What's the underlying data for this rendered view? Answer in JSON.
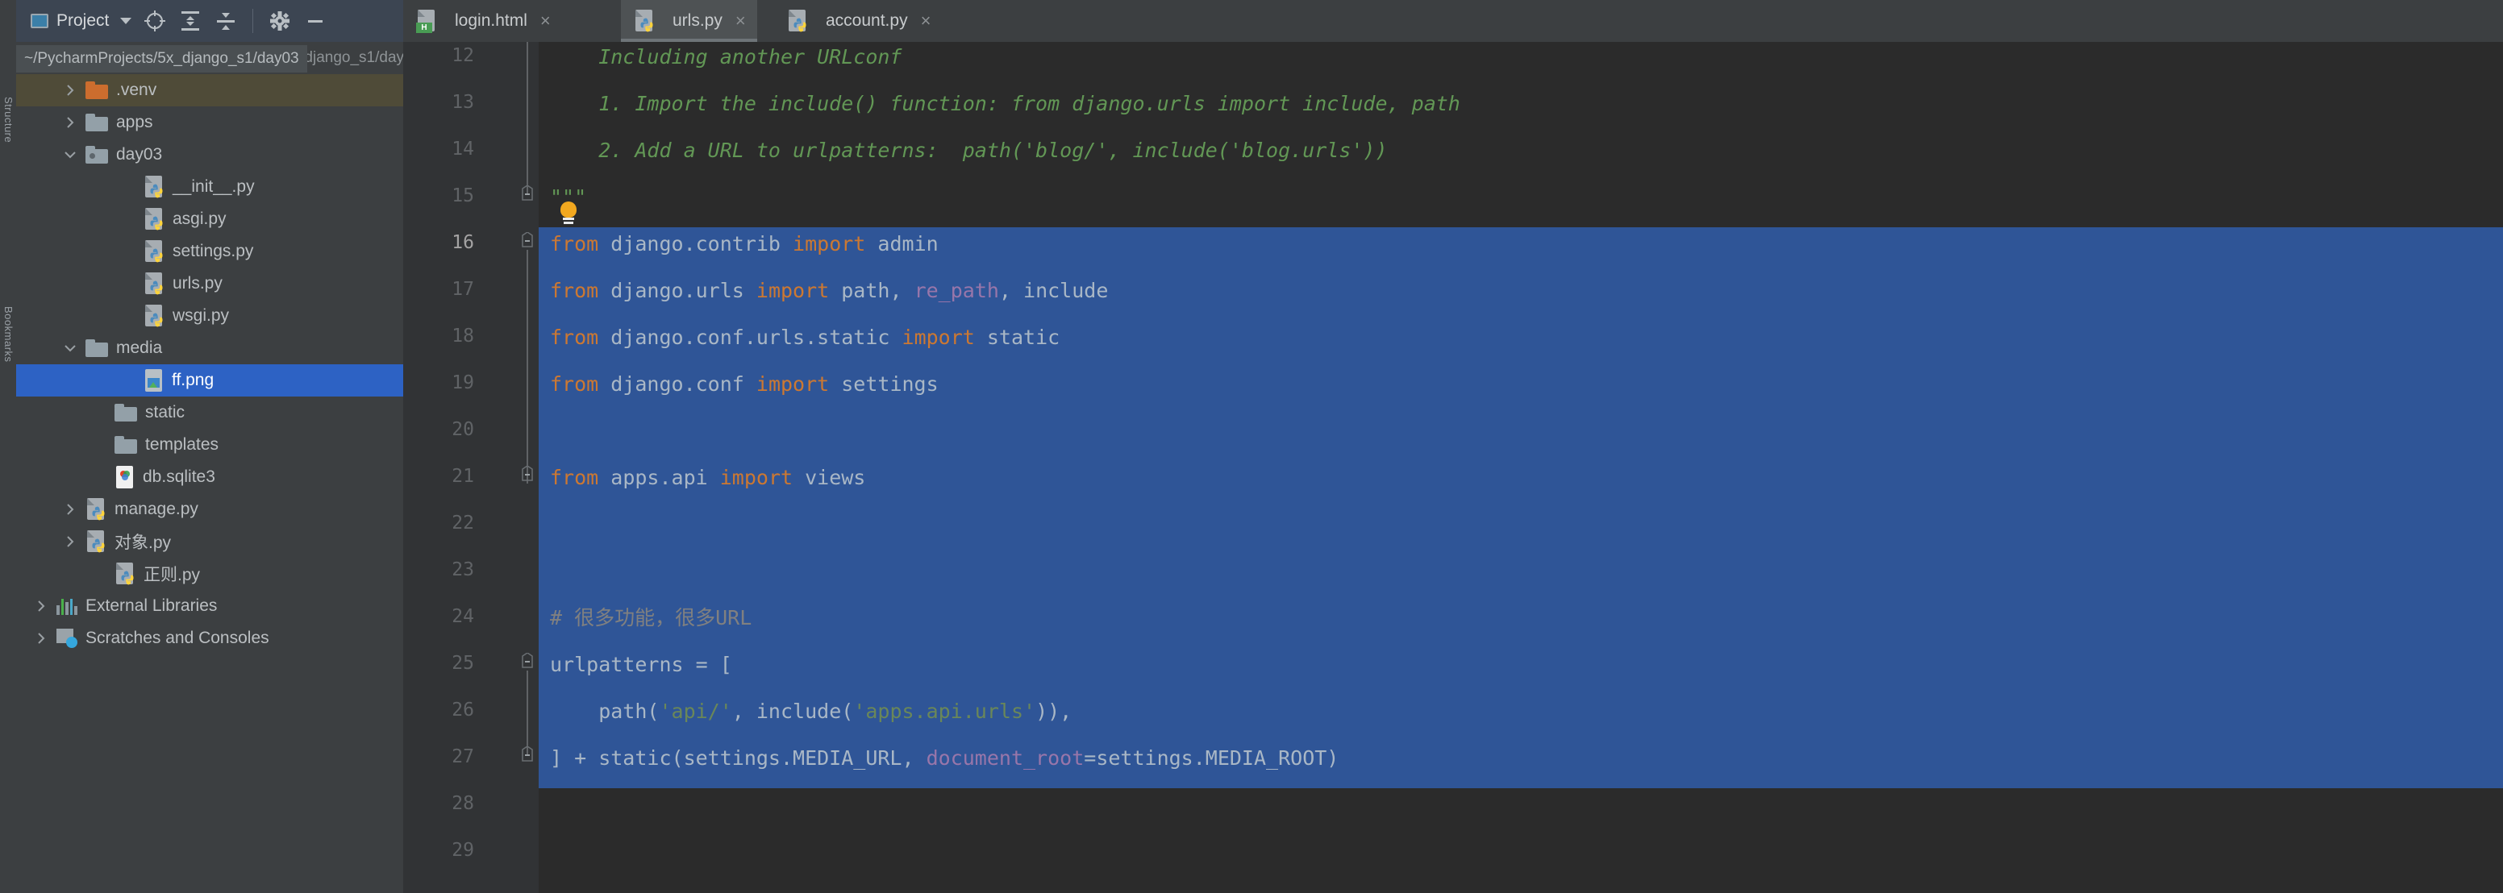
{
  "toolbar": {
    "project_label": "Project",
    "icons": [
      {
        "name": "locate-icon",
        "glyph": "target"
      },
      {
        "name": "expand-all-icon",
        "glyph": "expand"
      },
      {
        "name": "collapse-all-icon",
        "glyph": "collapse"
      },
      {
        "name": "settings-gear-icon",
        "glyph": "gear"
      },
      {
        "name": "hide-panel-icon",
        "glyph": "minus"
      }
    ]
  },
  "left_strip": {
    "labels": [
      "Structure",
      "Bookmarks"
    ]
  },
  "tabs": [
    {
      "label": "login.html",
      "icon": "html-file-icon",
      "active": false,
      "close": "×"
    },
    {
      "label": "urls.py",
      "icon": "python-file-icon",
      "active": true,
      "close": "×"
    },
    {
      "label": "account.py",
      "icon": "python-file-icon",
      "active": false,
      "close": "×"
    }
  ],
  "path_tooltip": "~/PycharmProjects/5x_django_s1/day03",
  "project_tree": {
    "root_label": "day03",
    "root_path": "~/PycharmProjects/5x_django_s1/day03",
    "items": [
      {
        "label": "day03",
        "path": "~/PycharmProjects/5x_django_s1/day03",
        "indent": 0,
        "arrow": "down",
        "icon": "folder-icon",
        "state": "root"
      },
      {
        "label": ".venv",
        "indent": 1,
        "arrow": "right",
        "icon": "folder-orange-icon",
        "state": "hover"
      },
      {
        "label": "apps",
        "indent": 1,
        "arrow": "right",
        "icon": "folder-icon",
        "state": "normal"
      },
      {
        "label": "day03",
        "indent": 1,
        "arrow": "down",
        "icon": "folder-source-icon",
        "state": "normal"
      },
      {
        "label": "__init__.py",
        "indent": 3,
        "arrow": "none",
        "icon": "python-file-icon",
        "state": "normal"
      },
      {
        "label": "asgi.py",
        "indent": 3,
        "arrow": "none",
        "icon": "python-file-icon",
        "state": "normal"
      },
      {
        "label": "settings.py",
        "indent": 3,
        "arrow": "none",
        "icon": "python-file-icon",
        "state": "normal"
      },
      {
        "label": "urls.py",
        "indent": 3,
        "arrow": "none",
        "icon": "python-file-icon",
        "state": "normal"
      },
      {
        "label": "wsgi.py",
        "indent": 3,
        "arrow": "none",
        "icon": "python-file-icon",
        "state": "normal"
      },
      {
        "label": "media",
        "indent": 1,
        "arrow": "down",
        "icon": "folder-icon",
        "state": "normal"
      },
      {
        "label": "ff.png",
        "indent": 3,
        "arrow": "none",
        "icon": "image-file-icon",
        "state": "selected"
      },
      {
        "label": "static",
        "indent": 2,
        "arrow": "none",
        "icon": "folder-icon",
        "state": "normal"
      },
      {
        "label": "templates",
        "indent": 2,
        "arrow": "none",
        "icon": "folder-icon",
        "state": "normal"
      },
      {
        "label": "db.sqlite3",
        "indent": 2,
        "arrow": "none",
        "icon": "sqlite-file-icon",
        "state": "normal"
      },
      {
        "label": "manage.py",
        "indent": 1,
        "arrow": "right",
        "icon": "python-file-icon",
        "state": "normal"
      },
      {
        "label": "对象.py",
        "indent": 1,
        "arrow": "right",
        "icon": "python-file-icon",
        "state": "normal"
      },
      {
        "label": "正则.py",
        "indent": 2,
        "arrow": "none",
        "icon": "python-file-icon",
        "state": "normal"
      },
      {
        "label": "External Libraries",
        "indent": 0,
        "arrow": "right",
        "icon": "library-icon",
        "state": "normal"
      },
      {
        "label": "Scratches and Consoles",
        "indent": 0,
        "arrow": "right",
        "icon": "scratches-icon",
        "state": "normal"
      }
    ]
  },
  "editor": {
    "file": "urls.py",
    "first_line": 12,
    "last_line": 29,
    "caret_line": 16,
    "selection_from_line": 16,
    "selection_to_line": 27,
    "line_numbers": [
      12,
      13,
      14,
      15,
      16,
      17,
      18,
      19,
      20,
      21,
      22,
      23,
      24,
      25,
      26,
      27,
      28,
      29
    ],
    "lines": [
      {
        "n": 12,
        "text": "    Including another URLconf",
        "type": "doc"
      },
      {
        "n": 13,
        "text": "    1. Import the include() function: from django.urls import include, path",
        "type": "doc"
      },
      {
        "n": 14,
        "text": "    2. Add a URL to urlpatterns:  path('blog/', include('blog.urls'))",
        "type": "doc"
      },
      {
        "n": 15,
        "text": "\"\"\"",
        "type": "doc"
      },
      {
        "n": 16,
        "text": "from django.contrib import admin",
        "type": "code"
      },
      {
        "n": 17,
        "text": "from django.urls import path, re_path, include",
        "type": "code"
      },
      {
        "n": 18,
        "text": "from django.conf.urls.static import static",
        "type": "code"
      },
      {
        "n": 19,
        "text": "from django.conf import settings",
        "type": "code"
      },
      {
        "n": 20,
        "text": "",
        "type": "code"
      },
      {
        "n": 21,
        "text": "from apps.api import views",
        "type": "code"
      },
      {
        "n": 22,
        "text": "",
        "type": "code"
      },
      {
        "n": 23,
        "text": "",
        "type": "code"
      },
      {
        "n": 24,
        "text": "# 很多功能，很多URL",
        "type": "code"
      },
      {
        "n": 25,
        "text": "urlpatterns = [",
        "type": "code"
      },
      {
        "n": 26,
        "text": "    path('api/', include('apps.api.urls')),",
        "type": "code"
      },
      {
        "n": 27,
        "text": "] + static(settings.MEDIA_URL, document_root=settings.MEDIA_ROOT)",
        "type": "code"
      },
      {
        "n": 28,
        "text": "",
        "type": "code"
      },
      {
        "n": 29,
        "text": "",
        "type": "code"
      }
    ]
  },
  "colors": {
    "editor_bg": "#2b2b2b",
    "gutter_bg": "#313335",
    "panel_bg": "#3c3f41",
    "toolbar_bg": "#3c4552",
    "selection_blue": "#2f5597",
    "tree_selected_blue": "#2d62c4",
    "tree_hover_olive": "#4f4b38",
    "docstring_green": "#629755",
    "keyword_orange": "#cc7832",
    "string_green": "#6a8759",
    "named_arg_purple": "#9876aa",
    "comment_gray": "#808080",
    "identifier": "#a9b7c6"
  }
}
